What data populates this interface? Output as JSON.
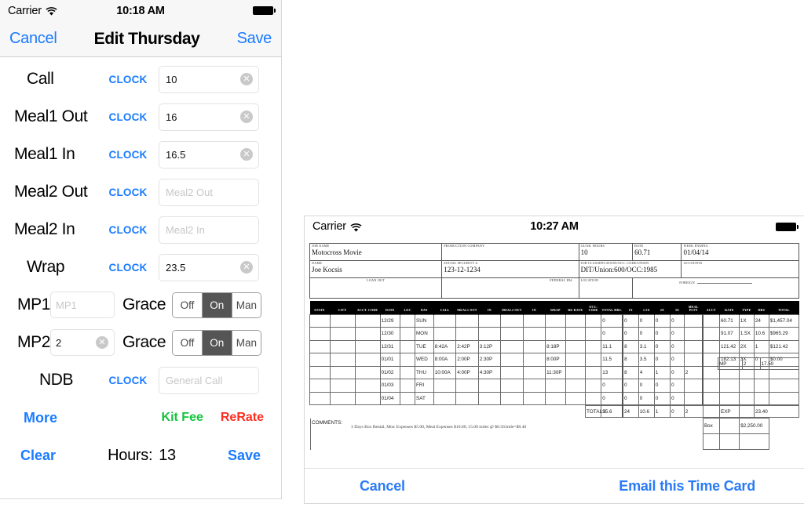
{
  "left_panel": {
    "statusbar": {
      "carrier": "Carrier",
      "time": "10:18 AM",
      "wifi_icon": "wifi-icon",
      "battery_icon": "battery-full-icon"
    },
    "navbar": {
      "cancel": "Cancel",
      "title": "Edit Thursday",
      "save": "Save"
    },
    "time_rows": [
      {
        "label": "Call",
        "clock": "CLOCK",
        "value": "10",
        "placeholder": "Call",
        "has_value": true,
        "clearable": true
      },
      {
        "label": "Meal1 Out",
        "clock": "CLOCK",
        "value": "16",
        "placeholder": "Meal1 Out",
        "has_value": true,
        "clearable": true
      },
      {
        "label": "Meal1 In",
        "clock": "CLOCK",
        "value": "16.5",
        "placeholder": "Meal1 In",
        "has_value": true,
        "clearable": true
      },
      {
        "label": "Meal2 Out",
        "clock": "CLOCK",
        "value": "",
        "placeholder": "Meal2 Out",
        "has_value": false,
        "clearable": false
      },
      {
        "label": "Meal2 In",
        "clock": "CLOCK",
        "value": "",
        "placeholder": "Meal2 In",
        "has_value": false,
        "clearable": false
      },
      {
        "label": "Wrap",
        "clock": "CLOCK",
        "value": "23.5",
        "placeholder": "Wrap",
        "has_value": true,
        "clearable": true
      }
    ],
    "mp_rows": [
      {
        "label": "MP1",
        "value": "",
        "placeholder": "MP1",
        "has_value": false,
        "grace_label": "Grace",
        "segments": [
          "Off",
          "On",
          "Man"
        ],
        "selected": "On"
      },
      {
        "label": "MP2",
        "value": "2",
        "placeholder": "MP2",
        "has_value": true,
        "grace_label": "Grace",
        "segments": [
          "Off",
          "On",
          "Man"
        ],
        "selected": "On"
      }
    ],
    "ndb_row": {
      "label": "NDB",
      "clock": "CLOCK",
      "value": "",
      "placeholder": "General Call"
    },
    "actions": {
      "more": "More",
      "kit_fee": "Kit Fee",
      "rerate": "ReRate",
      "clear": "Clear",
      "hours_label": "Hours:",
      "hours_value": "13",
      "save": "Save"
    },
    "colors": {
      "link_blue": "#1a7bff",
      "kit_fee_green": "#12c43a",
      "rerate_red": "#ff2d20",
      "segment_selected": "#555555"
    }
  },
  "right_panel": {
    "statusbar": {
      "carrier": "Carrier",
      "time": "10:27 AM",
      "wifi_icon": "wifi-icon",
      "battery_icon": "battery-full-icon"
    },
    "header_fields": {
      "job_name": {
        "label": "JOB NAME",
        "value": "Motocross Movie"
      },
      "production": {
        "label": "PRODUCTION COMPANY",
        "value": ""
      },
      "guar_hours": {
        "label": "GUAR. HOURS",
        "value": "10"
      },
      "rate": {
        "label": "RATE",
        "value": "60.71"
      },
      "week_ending": {
        "label": "WEEK ENDING",
        "value": "01/04/14"
      },
      "name": {
        "label": "NAME",
        "value": "Joe Kocsis"
      },
      "ssn": {
        "label": "SOCIAL SECURITY #",
        "value": "123-12-1234"
      },
      "job_class": {
        "label": "JOB CLASSIFICATION/OCC. CODE/UNION",
        "value": "DIT/Union:600/OCC:1985"
      },
      "account": {
        "label": "ACCOUNT#",
        "value": ""
      },
      "loan_out": {
        "label": "LOAN OUT",
        "value": ""
      },
      "federal_id": {
        "label": "FEDERAL ID#",
        "value": ""
      },
      "location": {
        "label": "LOCATION",
        "value": ""
      },
      "foreign": {
        "label": "FOREIGN",
        "value": ""
      }
    },
    "table_headers": [
      "STATE",
      "CITY",
      "ACCT. CODE",
      "DATE",
      "LOC",
      "DAY",
      "CALL",
      "MEAL1 OUT",
      "IN",
      "MEAL2 OUT",
      "IN",
      "WRAP",
      "RE-RATE",
      "OCC. CODE",
      "TOTAL HRS.",
      "1X",
      "1.5X",
      "2X",
      "3X",
      "MEAL PLTY",
      "ACCT",
      "RATE",
      "TYPE",
      "HRS",
      "TOTAL"
    ],
    "rows": [
      {
        "state": "",
        "city": "",
        "acct_code": "",
        "date": "12/29",
        "loc": "",
        "day": "SUN",
        "call": "",
        "meal1out": "",
        "meal1in": "",
        "meal2out": "",
        "meal2in": "",
        "wrap": "",
        "rerate": "",
        "occ": "",
        "total_hrs": "0",
        "x1": "0",
        "x15": "0",
        "x2": "0",
        "x3": "0",
        "meal_plty": "",
        "acct": "",
        "rate": "60.71",
        "type": "1X",
        "hrs": "24",
        "total": "$1,457.04"
      },
      {
        "state": "",
        "city": "",
        "acct_code": "",
        "date": "12/30",
        "loc": "",
        "day": "MON",
        "call": "",
        "meal1out": "",
        "meal1in": "",
        "meal2out": "",
        "meal2in": "",
        "wrap": "",
        "rerate": "",
        "occ": "",
        "total_hrs": "0",
        "x1": "0",
        "x15": "0",
        "x2": "0",
        "x3": "0",
        "meal_plty": "",
        "acct": "",
        "rate": "91.07",
        "type": "1.5X",
        "hrs": "10.6",
        "total": "$965.29"
      },
      {
        "state": "",
        "city": "",
        "acct_code": "",
        "date": "12/31",
        "loc": "",
        "day": "TUE",
        "call": "8:42A",
        "meal1out": "2:42P",
        "meal1in": "3:12P",
        "meal2out": "",
        "meal2in": "",
        "wrap": "8:18P",
        "rerate": "",
        "occ": "",
        "total_hrs": "11.1",
        "x1": "8",
        "x15": "3.1",
        "x2": "0",
        "x3": "0",
        "meal_plty": "",
        "acct": "",
        "rate": "121.42",
        "type": "2X",
        "hrs": "1",
        "total": "$121.42"
      },
      {
        "state": "",
        "city": "",
        "acct_code": "",
        "date": "01/01",
        "loc": "",
        "day": "WED",
        "call": "8:00A",
        "meal1out": "2:00P",
        "meal1in": "2:30P",
        "meal2out": "",
        "meal2in": "",
        "wrap": "8:00P",
        "rerate": "",
        "occ": "",
        "total_hrs": "11.5",
        "x1": "8",
        "x15": "3.5",
        "x2": "0",
        "x3": "0",
        "meal_plty": "",
        "acct": "",
        "rate": "182.13",
        "type": "3X",
        "hrs": "0",
        "total": "$0.00"
      },
      {
        "state": "",
        "city": "",
        "acct_code": "",
        "date": "01/02",
        "loc": "",
        "day": "THU",
        "call": "10:00A",
        "meal1out": "4:00P",
        "meal1in": "4:30P",
        "meal2out": "",
        "meal2in": "",
        "wrap": "11:30P",
        "rerate": "",
        "occ": "",
        "total_hrs": "13",
        "x1": "8",
        "x15": "4",
        "x2": "1",
        "x3": "0",
        "meal_plty": "2",
        "acct": "",
        "rate": "",
        "type": "",
        "hrs": "",
        "total": ""
      },
      {
        "state": "",
        "city": "",
        "acct_code": "",
        "date": "01/03",
        "loc": "",
        "day": "FRI",
        "call": "",
        "meal1out": "",
        "meal1in": "",
        "meal2out": "",
        "meal2in": "",
        "wrap": "",
        "rerate": "",
        "occ": "",
        "total_hrs": "0",
        "x1": "0",
        "x15": "0",
        "x2": "0",
        "x3": "0",
        "meal_plty": "",
        "acct": "",
        "rate": "",
        "type": "",
        "hrs": "",
        "total": ""
      },
      {
        "state": "",
        "city": "",
        "acct_code": "",
        "date": "01/04",
        "loc": "",
        "day": "SAT",
        "call": "",
        "meal1out": "",
        "meal1in": "",
        "meal2out": "",
        "meal2in": "",
        "wrap": "",
        "rerate": "",
        "occ": "",
        "total_hrs": "0",
        "x1": "0",
        "x15": "0",
        "x2": "0",
        "x3": "0",
        "meal_plty": "",
        "acct": "",
        "rate": "",
        "type": "",
        "hrs": "",
        "total": ""
      }
    ],
    "totals_row": {
      "label": "TOTALS",
      "total_hrs": "35.6",
      "x1": "24",
      "x15": "10.6",
      "x2": "1",
      "x3": "0",
      "meal_plty": "2"
    },
    "summary_boxes": [
      {
        "label": "MP",
        "qty": "2",
        "amount": "17.50"
      },
      {
        "label": "EXP",
        "qty": "",
        "amount": "23.40"
      },
      {
        "label": "Box",
        "qty": "",
        "amount": "$2,250.00"
      }
    ],
    "comments": {
      "label": "COMMENTS:",
      "text": "3 Days Box Rental, Misc Expenses $5.00, Meal Expenses $10.00, 15.00 miles @ $0.56/mile=$8.40"
    },
    "footer": {
      "cancel": "Cancel",
      "email": "Email this Time Card"
    }
  }
}
